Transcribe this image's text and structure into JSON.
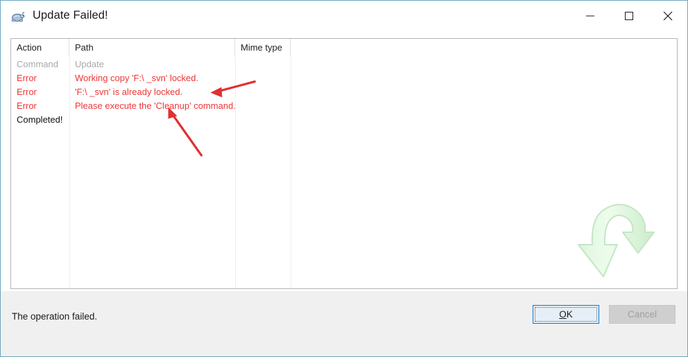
{
  "window": {
    "title": "Update Failed!",
    "icon": "tortoise-svn-icon",
    "border_color": "#6ba5bd"
  },
  "titlebar_controls": {
    "minimize": "minimize-icon",
    "maximize": "maximize-icon",
    "close": "close-icon"
  },
  "list": {
    "columns": [
      {
        "key": "action",
        "label": "Action"
      },
      {
        "key": "path",
        "label": "Path"
      },
      {
        "key": "mime",
        "label": "Mime type"
      }
    ],
    "rows": [
      {
        "action": "Command",
        "path": "Update",
        "type": "command"
      },
      {
        "action": "Error",
        "path": "Working copy 'F:\\          _svn' locked.",
        "type": "error"
      },
      {
        "action": "Error",
        "path": "'F:\\          _svn' is already locked.",
        "type": "error"
      },
      {
        "action": "Error",
        "path": "Please execute the 'Cleanup' command.",
        "type": "error"
      },
      {
        "action": "Completed!",
        "path": "",
        "type": "done"
      }
    ],
    "watermark_icon": "green-update-arrow-icon",
    "error_color": "#ef3535",
    "command_color": "#a9a9a9"
  },
  "annotations": {
    "arrow_color": "#e03131",
    "arrow_1": "red-annotation-arrow-icon",
    "arrow_2": "red-annotation-arrow-icon"
  },
  "footer": {
    "status": "The operation failed.",
    "ok_label_prefix": "",
    "ok_label_accel": "O",
    "ok_label_suffix": "K",
    "ok_label": "OK",
    "cancel_label": "Cancel"
  }
}
